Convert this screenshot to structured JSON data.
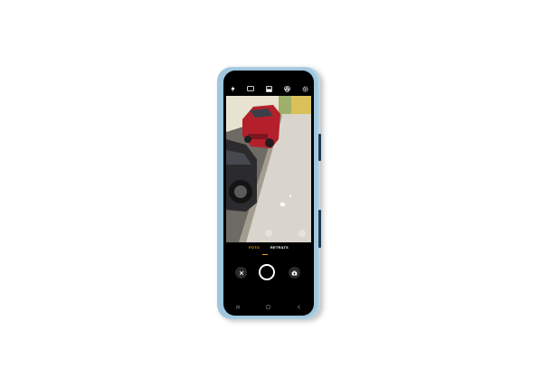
{
  "camera": {
    "top_icons": [
      "flash-icon",
      "aspect-ratio-icon",
      "hdr-icon",
      "filter-icon",
      "settings-icon"
    ],
    "modes": [
      {
        "label": "FOTO",
        "active": true
      },
      {
        "label": "RETRATS",
        "active": false
      }
    ],
    "accent_color": "#f0a020",
    "left_control": "close-icon",
    "right_control": "switch-camera-icon",
    "nav_icons": [
      "recents-icon",
      "home-icon",
      "back-icon"
    ]
  },
  "device": {
    "frame_color": "#9fc6dd"
  }
}
